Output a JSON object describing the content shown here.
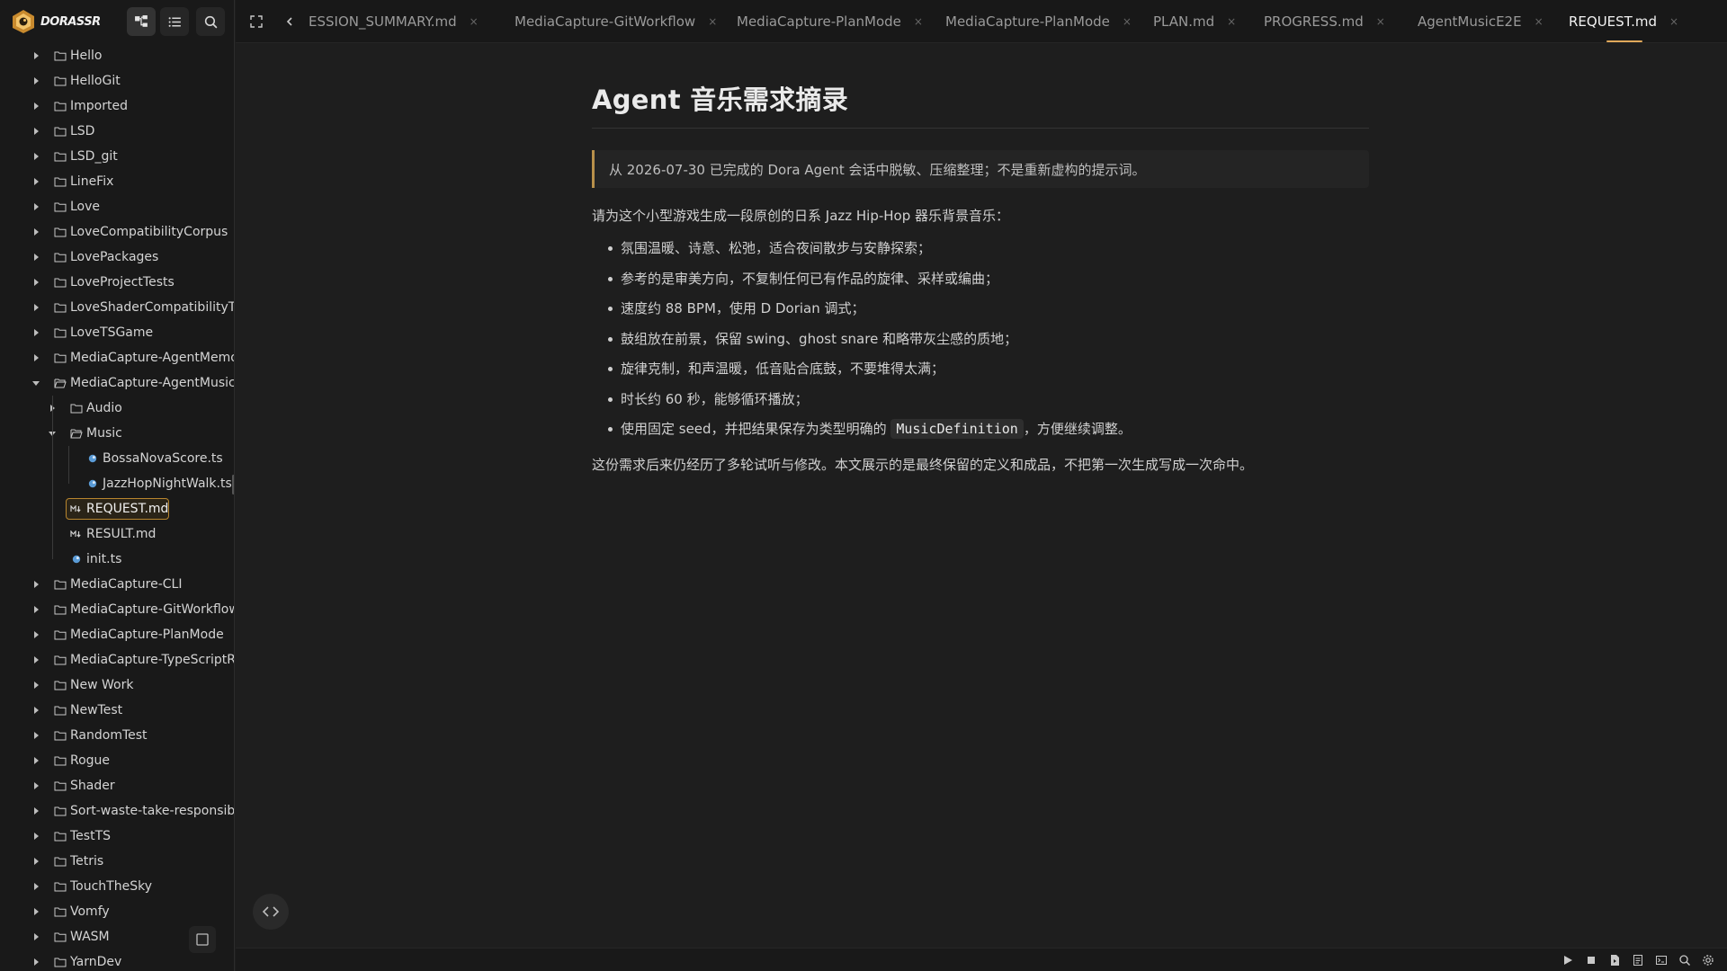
{
  "app": {
    "brand": "DORASSR",
    "accent": "#e0a85a"
  },
  "sidebar": {
    "head_buttons": [
      {
        "name": "file-tree-icon",
        "active": true
      },
      {
        "name": "outline-list-icon",
        "active": false
      },
      {
        "name": "search-icon",
        "active": false
      }
    ],
    "items": [
      {
        "label": "Hello",
        "type": "folder",
        "depth": 0,
        "expanded": false
      },
      {
        "label": "HelloGit",
        "type": "folder",
        "depth": 0,
        "expanded": false
      },
      {
        "label": "Imported",
        "type": "folder",
        "depth": 0,
        "expanded": false
      },
      {
        "label": "LSD",
        "type": "folder",
        "depth": 0,
        "expanded": false
      },
      {
        "label": "LSD_git",
        "type": "folder",
        "depth": 0,
        "expanded": false
      },
      {
        "label": "LineFix",
        "type": "folder",
        "depth": 0,
        "expanded": false
      },
      {
        "label": "Love",
        "type": "folder",
        "depth": 0,
        "expanded": false
      },
      {
        "label": "LoveCompatibilityCorpus",
        "type": "folder",
        "depth": 0,
        "expanded": false
      },
      {
        "label": "LovePackages",
        "type": "folder",
        "depth": 0,
        "expanded": false
      },
      {
        "label": "LoveProjectTests",
        "type": "folder",
        "depth": 0,
        "expanded": false
      },
      {
        "label": "LoveShaderCompatibilityTes",
        "type": "folder",
        "depth": 0,
        "expanded": false
      },
      {
        "label": "LoveTSGame",
        "type": "folder",
        "depth": 0,
        "expanded": false
      },
      {
        "label": "MediaCapture-AgentMemor",
        "type": "folder",
        "depth": 0,
        "expanded": false
      },
      {
        "label": "MediaCapture-AgentMusic",
        "type": "folder",
        "depth": 0,
        "expanded": true
      },
      {
        "label": "Audio",
        "type": "folder",
        "depth": 1,
        "expanded": false
      },
      {
        "label": "Music",
        "type": "folder",
        "depth": 1,
        "expanded": true
      },
      {
        "label": "BossaNovaScore.ts",
        "type": "ts",
        "depth": 2
      },
      {
        "label": "JazzHopNightWalk.ts",
        "type": "ts",
        "depth": 2
      },
      {
        "label": "REQUEST.md",
        "type": "md",
        "depth": 1,
        "selected": true
      },
      {
        "label": "RESULT.md",
        "type": "md",
        "depth": 1
      },
      {
        "label": "init.ts",
        "type": "ts",
        "depth": 1
      },
      {
        "label": "MediaCapture-CLI",
        "type": "folder",
        "depth": 0,
        "expanded": false
      },
      {
        "label": "MediaCapture-GitWorkflow",
        "type": "folder",
        "depth": 0,
        "expanded": false
      },
      {
        "label": "MediaCapture-PlanMode",
        "type": "folder",
        "depth": 0,
        "expanded": false
      },
      {
        "label": "MediaCapture-TypeScriptRc",
        "type": "folder",
        "depth": 0,
        "expanded": false
      },
      {
        "label": "New Work",
        "type": "folder",
        "depth": 0,
        "expanded": false
      },
      {
        "label": "NewTest",
        "type": "folder",
        "depth": 0,
        "expanded": false
      },
      {
        "label": "RandomTest",
        "type": "folder",
        "depth": 0,
        "expanded": false
      },
      {
        "label": "Rogue",
        "type": "folder",
        "depth": 0,
        "expanded": false
      },
      {
        "label": "Shader",
        "type": "folder",
        "depth": 0,
        "expanded": false
      },
      {
        "label": "Sort-waste-take-responsibi",
        "type": "folder",
        "depth": 0,
        "expanded": false
      },
      {
        "label": "TestTS",
        "type": "folder",
        "depth": 0,
        "expanded": false
      },
      {
        "label": "Tetris",
        "type": "folder",
        "depth": 0,
        "expanded": false
      },
      {
        "label": "TouchTheSky",
        "type": "folder",
        "depth": 0,
        "expanded": false
      },
      {
        "label": "Vomfy",
        "type": "folder",
        "depth": 0,
        "expanded": false
      },
      {
        "label": "WASM",
        "type": "folder",
        "depth": 0,
        "expanded": false
      },
      {
        "label": "YarnDev",
        "type": "folder",
        "depth": 0,
        "expanded": false
      }
    ]
  },
  "tabs": [
    {
      "label": "ESSION_SUMMARY.md",
      "active": false
    },
    {
      "label": "MediaCapture-GitWorkflow",
      "active": false
    },
    {
      "label": "MediaCapture-PlanMode",
      "active": false
    },
    {
      "label": "MediaCapture-PlanMode",
      "active": false
    },
    {
      "label": "PLAN.md",
      "active": false
    },
    {
      "label": "PROGRESS.md",
      "active": false
    },
    {
      "label": "AgentMusicE2E",
      "active": false
    },
    {
      "label": "REQUEST.md",
      "active": true
    }
  ],
  "tab_close_glyph": "×",
  "document": {
    "title": "Agent 音乐需求摘录",
    "quote": "从 2026-07-30 已完成的 Dora Agent 会话中脱敏、压缩整理；不是重新虚构的提示词。",
    "intro": "请为这个小型游戏生成一段原创的日系 Jazz Hip-Hop 器乐背景音乐：",
    "bullets": [
      "氛围温暖、诗意、松弛，适合夜间散步与安静探索；",
      "参考的是审美方向，不复制任何已有作品的旋律、采样或编曲；",
      "速度约 88 BPM，使用 D Dorian 调式；",
      "鼓组放在前景，保留 swing、ghost snare 和略带灰尘感的质地；",
      "旋律克制，和声温暖，低音贴合底鼓，不要堆得太满；",
      "时长约 60 秒，能够循环播放；"
    ],
    "last_bullet_pre": "使用固定 seed，并把结果保存为类型明确的 ",
    "last_bullet_code": "MusicDefinition",
    "last_bullet_post": "，方便继续调整。",
    "outro": "这份需求后来仍经历了多轮试听与修改。本文展示的是最终保留的定义和成品，不把第一次生成写成一次命中。"
  },
  "statusbar": {
    "icons": [
      "play-icon",
      "stop-icon",
      "file-run-icon",
      "document-icon",
      "terminal-icon",
      "search-icon",
      "settings-gear-icon"
    ]
  }
}
